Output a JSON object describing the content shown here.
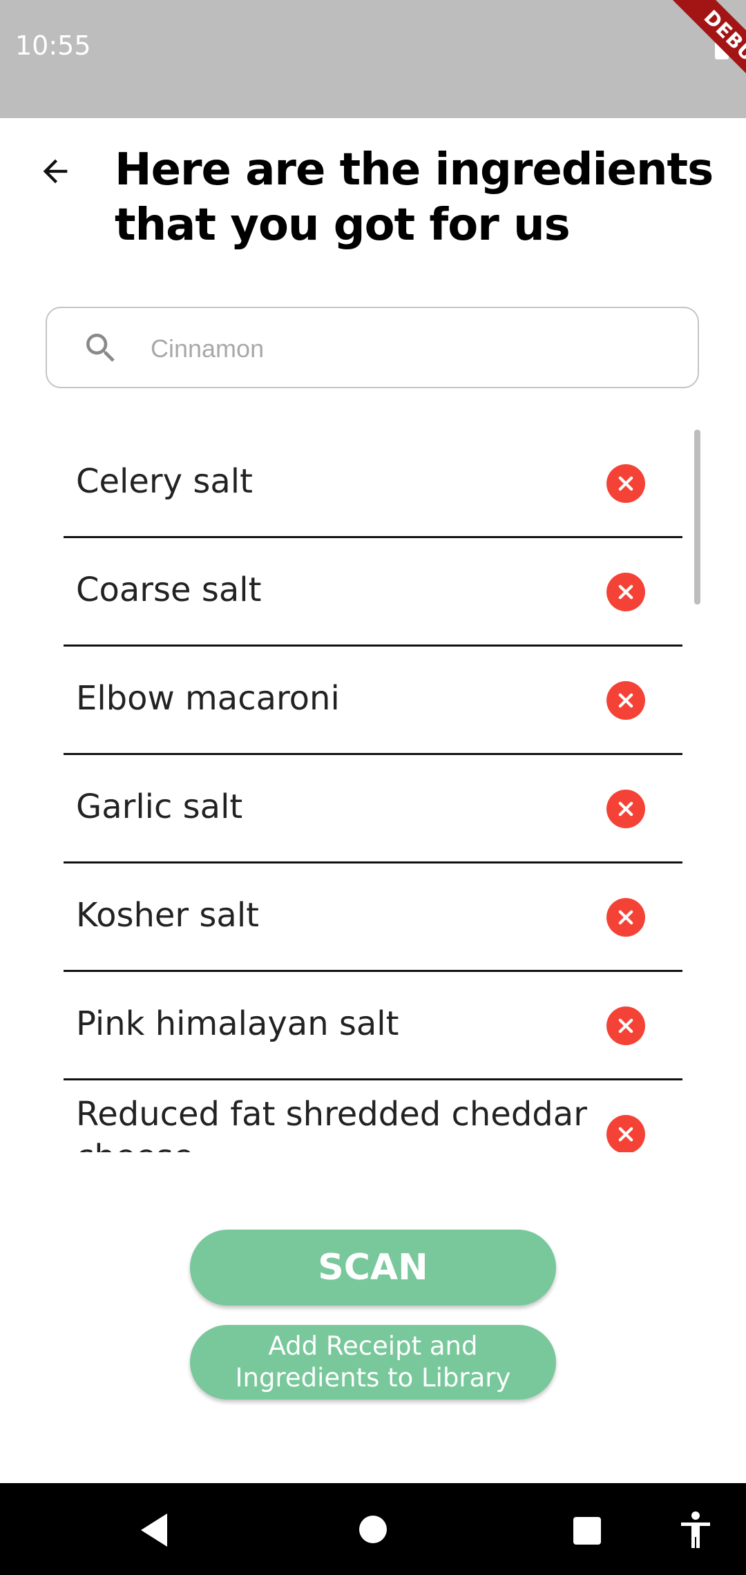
{
  "status_bar": {
    "time": "10:55",
    "debug_label": "DEBUG"
  },
  "header": {
    "title": "Here are the ingredients that you got for us"
  },
  "search": {
    "placeholder": "Cinnamon",
    "value": ""
  },
  "ingredients": [
    "Celery salt",
    "Coarse salt",
    "Elbow macaroni",
    "Garlic salt",
    "Kosher salt",
    "Pink himalayan salt",
    "Reduced fat shredded cheddar cheese"
  ],
  "actions": {
    "scan_label": "SCAN",
    "add_label": "Add Receipt and\nIngredients to Library"
  },
  "colors": {
    "accent": "#78c89b",
    "remove": "#f44336",
    "status_bar": "#bdbdbd",
    "debug_banner": "#a31515"
  },
  "icons": {
    "back": "arrow-left-icon",
    "search": "search-icon",
    "remove": "close-circle-icon",
    "nav": [
      "back-triangle-icon",
      "home-circle-icon",
      "recents-square-icon",
      "accessibility-icon"
    ]
  }
}
